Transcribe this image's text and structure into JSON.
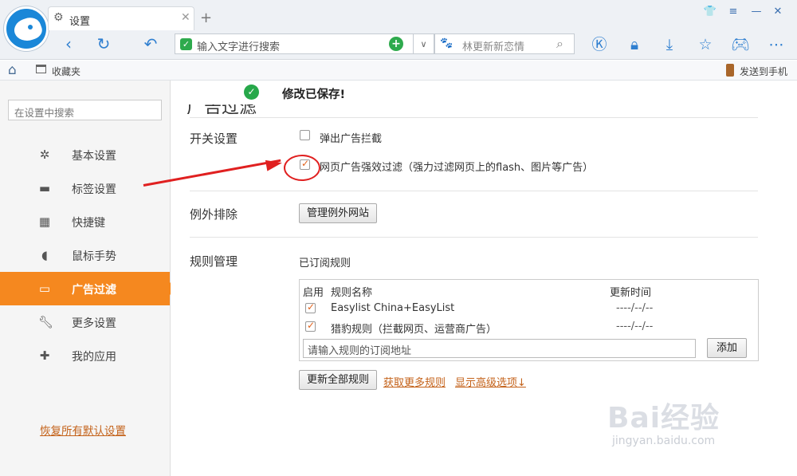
{
  "browser": {
    "tab_title": "设置",
    "address_placeholder": "输入文字进行搜索",
    "search_text": "林更新新恋情",
    "bookmarks_label": "收藏夹",
    "send_to_phone": "发送到手机"
  },
  "notice": {
    "saved": "修改已保存!"
  },
  "sidebar": {
    "search_placeholder": "在设置中搜索",
    "items": [
      {
        "label": "基本设置",
        "icon": "gear-icon"
      },
      {
        "label": "标签设置",
        "icon": "laptop-icon"
      },
      {
        "label": "快捷键",
        "icon": "keyboard-icon"
      },
      {
        "label": "鼠标手势",
        "icon": "mouse-icon"
      },
      {
        "label": "广告过滤",
        "icon": "window-icon",
        "active": true
      },
      {
        "label": "更多设置",
        "icon": "wrench-icon"
      },
      {
        "label": "我的应用",
        "icon": "puzzle-icon"
      }
    ],
    "restore_defaults": "恢复所有默认设置"
  },
  "main": {
    "section_title": "广告过滤",
    "switch_label": "开关设置",
    "popup_block": {
      "label": "弹出广告拦截",
      "checked": false
    },
    "strong_filter": {
      "label": "网页广告强效过滤（强力过滤网页上的flash、图片等广告）",
      "checked": true
    },
    "exception_label": "例外排除",
    "manage_exceptions_button": "管理例外网站",
    "rules_label": "规则管理",
    "subscribed_label": "已订阅规则",
    "table_headers": {
      "enabled": "启用",
      "name": "规则名称",
      "updated": "更新时间"
    },
    "rules": [
      {
        "name": "Easylist China+EasyList",
        "updated": "----/--/--",
        "enabled": true
      },
      {
        "name": "猎豹规则（拦截网页、运营商广告）",
        "updated": "----/--/--",
        "enabled": true
      }
    ],
    "subscribe_placeholder": "请输入规则的订阅地址",
    "add_button": "添加",
    "update_all_button": "更新全部规则",
    "more_rules_link": "获取更多规则",
    "advanced_link": "显示高级选项↓"
  },
  "watermark": {
    "main": "Bai经验",
    "sub": "jingyan.baidu.com"
  },
  "colors": {
    "accent": "#f5881f",
    "link": "#c4621a",
    "annotation": "#e02020"
  }
}
